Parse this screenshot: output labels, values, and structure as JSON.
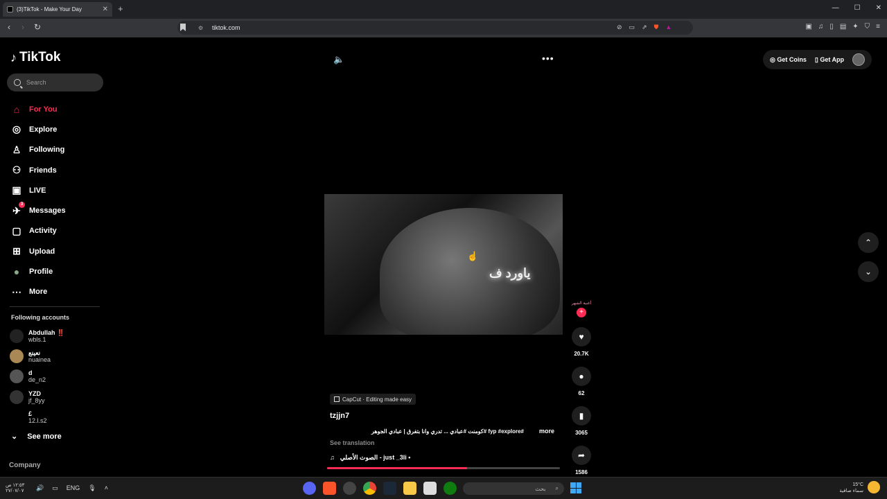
{
  "browser": {
    "tab_title": "(3)TikTok - Make Your Day",
    "new_tab": "+",
    "url": "tiktok.com",
    "window_controls": [
      "—",
      "☐",
      "✕"
    ]
  },
  "sidebar": {
    "logo": "TikTok",
    "search_placeholder": "Search",
    "items": [
      {
        "label": "For You",
        "icon": "home-icon",
        "glyph": "⌂"
      },
      {
        "label": "Explore",
        "icon": "compass-icon",
        "glyph": "◎"
      },
      {
        "label": "Following",
        "icon": "user-icon",
        "glyph": "♙"
      },
      {
        "label": "Friends",
        "icon": "friends-icon",
        "glyph": "⚇"
      },
      {
        "label": "LIVE",
        "icon": "live-icon",
        "glyph": "▣"
      },
      {
        "label": "Messages",
        "icon": "send-icon",
        "glyph": "✈",
        "badge": "3"
      },
      {
        "label": "Activity",
        "icon": "activity-icon",
        "glyph": "▢"
      },
      {
        "label": "Upload",
        "icon": "upload-icon",
        "glyph": "⊞"
      },
      {
        "label": "Profile",
        "icon": "avatar-icon",
        "glyph": "●"
      },
      {
        "label": "More",
        "icon": "more-icon",
        "glyph": "⋯"
      }
    ],
    "following_title": "Following accounts",
    "accounts": [
      {
        "name": "Abdullah ‼️",
        "handle": "wbls.1"
      },
      {
        "name": "نعينع",
        "handle": "nuainea"
      },
      {
        "name": "d",
        "handle": "de_n2"
      },
      {
        "name": "YZD",
        "handle": "jf_8yy"
      },
      {
        "name": "£",
        "handle": "12.l.s2"
      }
    ],
    "see_more": "See more",
    "company": "Company"
  },
  "header": {
    "get_coins": "Get Coins",
    "get_app": "Get App"
  },
  "video": {
    "overlay_text": "ياورد ف",
    "capcut": "CapCut · Editing made easy",
    "username": "tzjjn7",
    "description": "#fyp #explore #كومنت #عبادي ... تدري وانا بتفرق | عبادي الجوهر",
    "more": "more",
    "see_translation": "See translation",
    "music": "الصوت الأصلي - just _3li •",
    "progress": 0.6
  },
  "actions": {
    "creator_label": "أغنية الشهر",
    "likes": "20.7K",
    "comments": "62",
    "saves": "3065",
    "shares": "1586"
  },
  "taskbar": {
    "time": "١٢:٥٣ ص",
    "date": "٢٧/٠٧/٠٧",
    "lang": "ENG",
    "search": "بحث",
    "weather_temp": "15°C",
    "weather_desc": "سماء صافية"
  }
}
